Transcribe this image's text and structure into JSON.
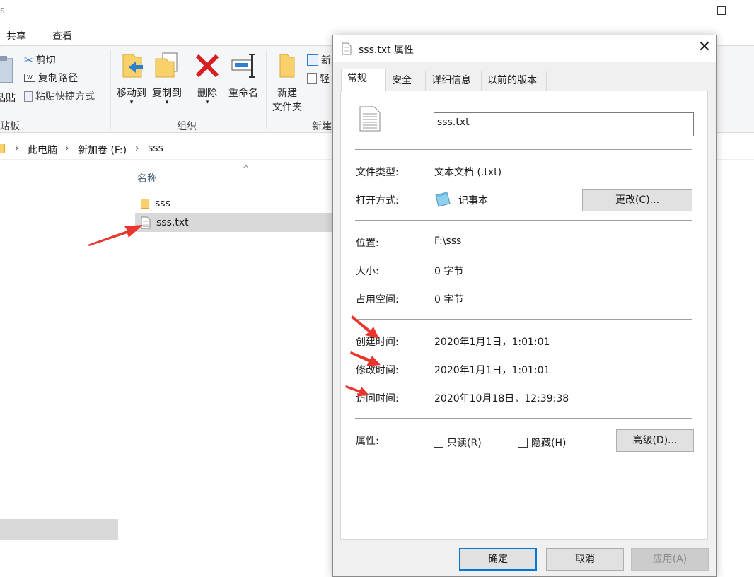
{
  "explorer": {
    "title_fragment": "s",
    "ribbon_tabs": [
      "共享",
      "查看"
    ],
    "clipboard": {
      "paste_label": "粘贴",
      "cut": "剪切",
      "copy_path": "复制路径",
      "paste_shortcut": "粘贴快捷方式",
      "group": "贴板"
    },
    "organize": {
      "move_to": "移动到",
      "copy_to": "复制到",
      "delete": "删除",
      "rename": "重命名",
      "group": "组织"
    },
    "new_group": {
      "new_folder_line1": "新建",
      "new_folder_line2": "文件夹",
      "new_item": "新",
      "easy_access": "轻",
      "group": "新建"
    },
    "breadcrumb": [
      "此电脑",
      "新加卷 (F:)",
      "sss"
    ],
    "column_header": "名称",
    "files": [
      {
        "name": "sss",
        "type": "folder"
      },
      {
        "name": "sss.txt",
        "type": "text-file"
      }
    ]
  },
  "dialog": {
    "title": "sss.txt 属性",
    "tabs": [
      "常规",
      "安全",
      "详细信息",
      "以前的版本"
    ],
    "file_name": "sss.txt",
    "file_type_label": "文件类型:",
    "file_type_value": "文本文档 (.txt)",
    "opens_with_label": "打开方式:",
    "opens_with_value": "记事本",
    "change_button": "更改(C)...",
    "location_label": "位置:",
    "location_value": "F:\\sss",
    "size_label": "大小:",
    "size_value": "0 字节",
    "size_on_disk_label": "占用空间:",
    "size_on_disk_value": "0 字节",
    "created_label": "创建时间:",
    "created_value": "2020年1月1日，1:01:01",
    "modified_label": "修改时间:",
    "modified_value": "2020年1月1日，1:01:01",
    "accessed_label": "访问时间:",
    "accessed_value": "2020年10月18日，12:39:38",
    "attributes_label": "属性:",
    "readonly_label": "只读(R)",
    "hidden_label": "隐藏(H)",
    "advanced_button": "高级(D)...",
    "ok_button": "确定",
    "cancel_button": "取消",
    "apply_button": "应用(A)"
  },
  "colors": {
    "annotation_arrow": "#e8352d",
    "focus_border": "#0078d7",
    "selection": "#d9d9d9"
  }
}
